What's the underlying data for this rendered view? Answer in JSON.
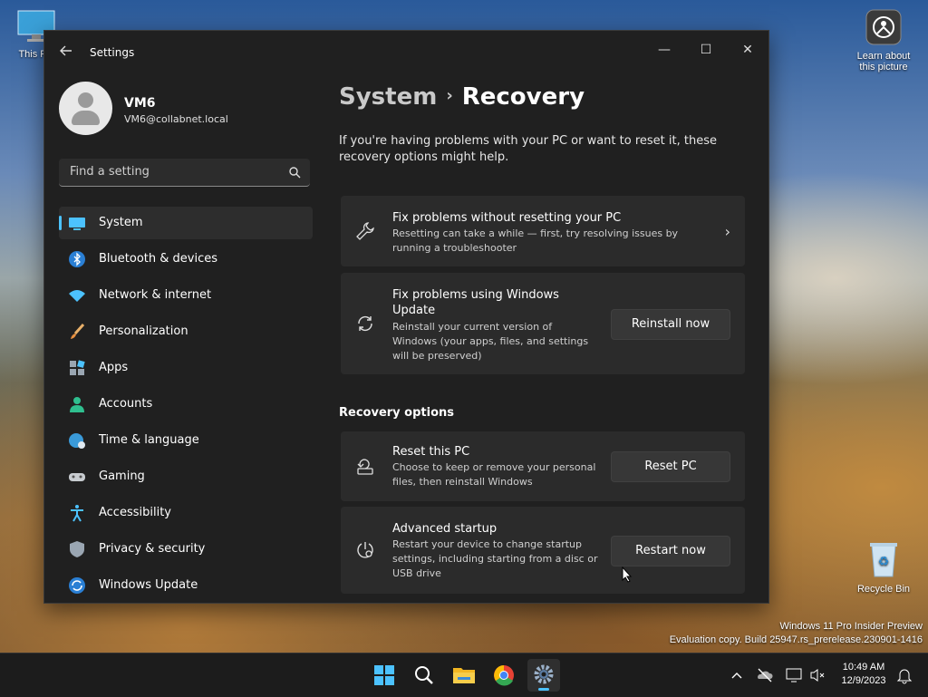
{
  "desktop": {
    "this_pc_label": "This PC",
    "learn_label_1": "Learn about",
    "learn_label_2": "this picture",
    "recycle_label": "Recycle Bin",
    "watermark_line1": "Windows 11 Pro Insider Preview",
    "watermark_line2": "Evaluation copy. Build 25947.rs_prerelease.230901-1416"
  },
  "window": {
    "title": "Settings",
    "minimize": "—",
    "maximize": "☐",
    "close": "✕"
  },
  "profile": {
    "name": "VM6",
    "email": "VM6@collabnet.local"
  },
  "search": {
    "placeholder": "Find a setting"
  },
  "nav": {
    "items": [
      {
        "label": "System",
        "icon": "system-icon"
      },
      {
        "label": "Bluetooth & devices",
        "icon": "bluetooth-icon"
      },
      {
        "label": "Network & internet",
        "icon": "wifi-icon"
      },
      {
        "label": "Personalization",
        "icon": "brush-icon"
      },
      {
        "label": "Apps",
        "icon": "apps-icon"
      },
      {
        "label": "Accounts",
        "icon": "accounts-icon"
      },
      {
        "label": "Time & language",
        "icon": "globe-clock-icon"
      },
      {
        "label": "Gaming",
        "icon": "gamepad-icon"
      },
      {
        "label": "Accessibility",
        "icon": "accessibility-icon"
      },
      {
        "label": "Privacy & security",
        "icon": "shield-icon"
      },
      {
        "label": "Windows Update",
        "icon": "update-icon"
      }
    ],
    "active_index": 0
  },
  "main": {
    "breadcrumb_parent": "System",
    "breadcrumb_sep": "›",
    "breadcrumb_current": "Recovery",
    "intro": "If you're having problems with your PC or want to reset it, these recovery options might help.",
    "cards": [
      {
        "title": "Fix problems without resetting your PC",
        "desc": "Resetting can take a while — first, try resolving issues by running a troubleshooter",
        "icon": "wrench-icon",
        "chevron": "›"
      },
      {
        "title": "Fix problems using Windows Update",
        "desc": "Reinstall your current version of Windows (your apps, files, and settings will be preserved)",
        "icon": "sync-icon",
        "button": "Reinstall now"
      }
    ],
    "section_title": "Recovery options",
    "options": [
      {
        "title": "Reset this PC",
        "desc": "Choose to keep or remove your personal files, then reinstall Windows",
        "icon": "reset-pc-icon",
        "button": "Reset PC"
      },
      {
        "title": "Advanced startup",
        "desc": "Restart your device to change startup settings, including starting from a disc or USB drive",
        "icon": "advanced-startup-icon",
        "button": "Restart now"
      }
    ]
  },
  "taskbar": {
    "apps": [
      "start-icon",
      "search-icon",
      "file-explorer-icon",
      "chrome-icon",
      "settings-icon"
    ],
    "active": "settings-icon",
    "time": "10:49 AM",
    "date": "12/9/2023"
  },
  "colors": {
    "accent": "#4cc2ff",
    "window_bg": "#202020",
    "card_bg": "#2b2b2b"
  }
}
